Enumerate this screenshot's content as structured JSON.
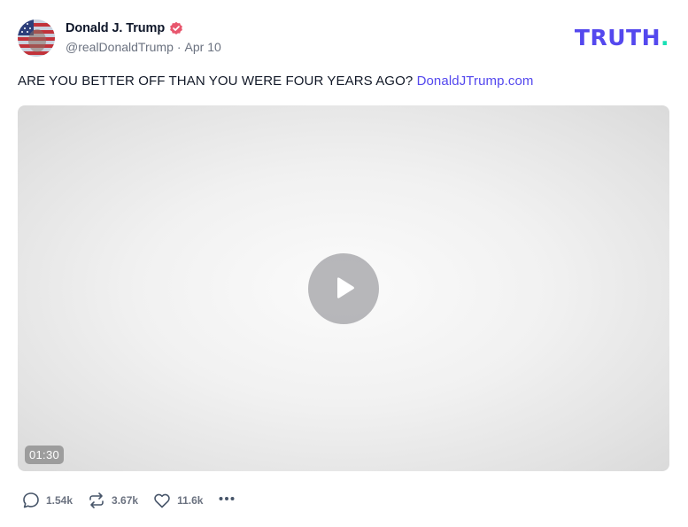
{
  "author": {
    "name": "Donald J. Trump",
    "handle": "@realDonaldTrump",
    "separator": "·",
    "date": "Apr 10"
  },
  "brand": {
    "logo_text": "TRUTH",
    "logo_dot": "."
  },
  "post": {
    "text": "ARE YOU BETTER OFF THAN YOU WERE FOUR YEARS AGO?",
    "link": "DonaldJTrump.com"
  },
  "video": {
    "duration": "01:30"
  },
  "actions": {
    "replies": "1.54k",
    "retruths": "3.67k",
    "likes": "11.6k"
  },
  "colors": {
    "accent": "#5448ee",
    "logo_dot": "#17e0b4",
    "verified": "#e8566d"
  }
}
